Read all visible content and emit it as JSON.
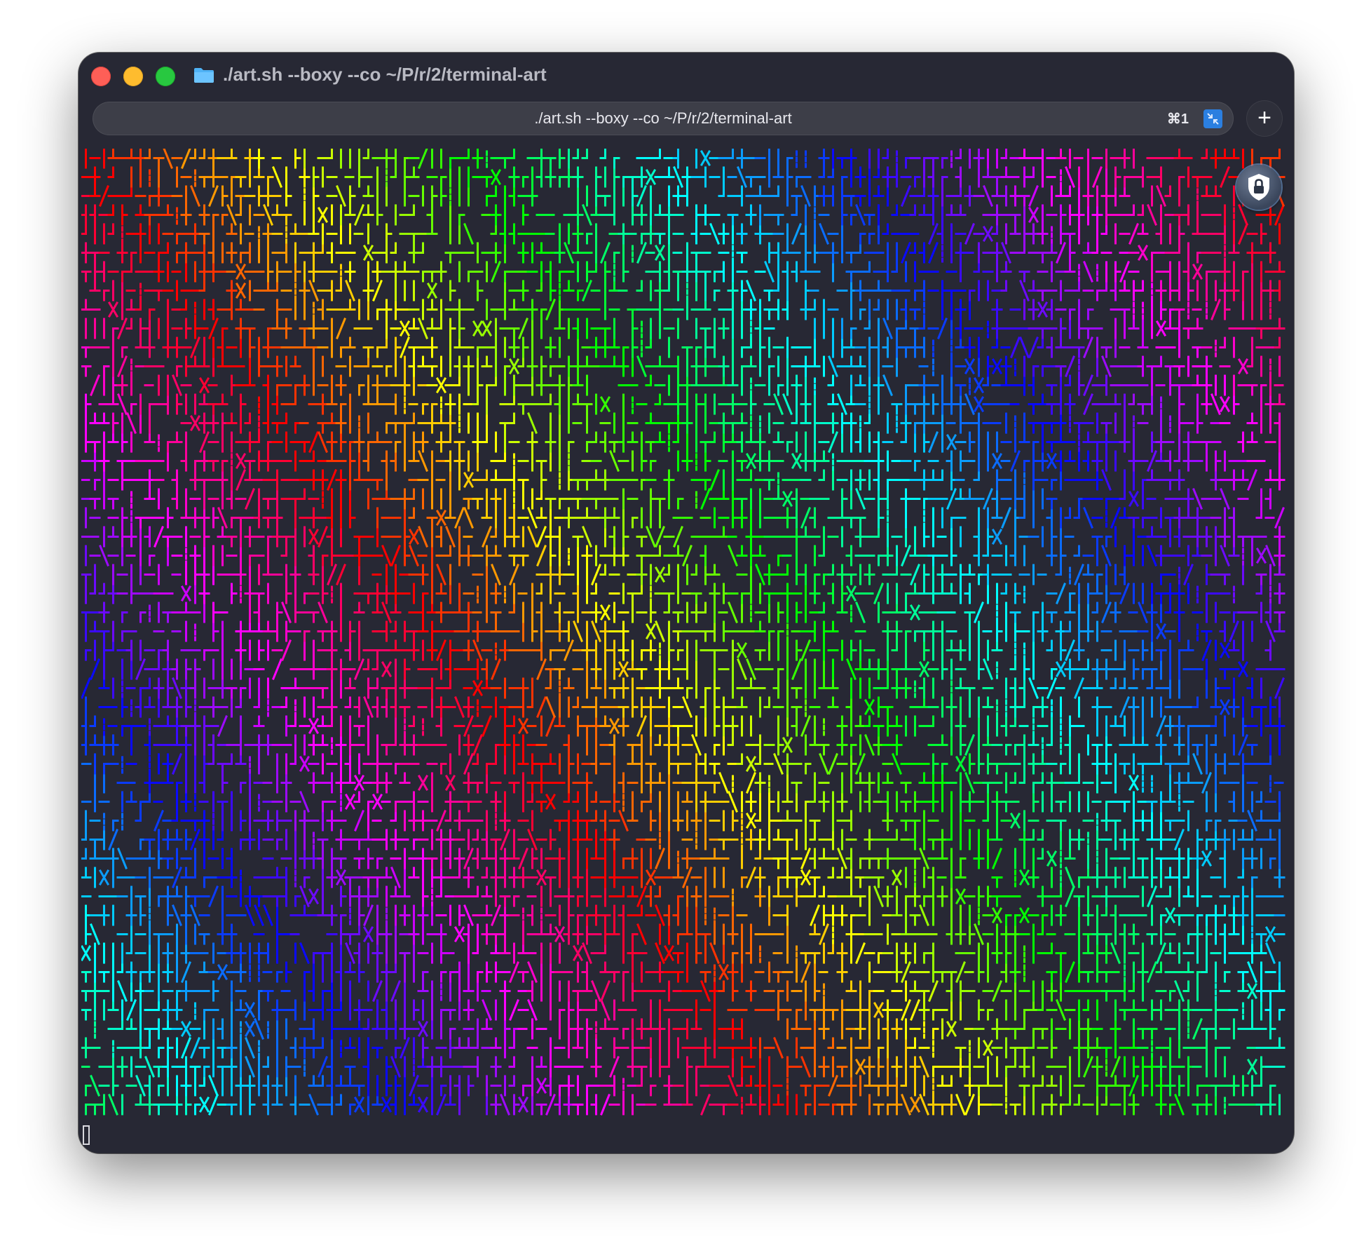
{
  "window": {
    "title": "./art.sh --boxy --co ~/P/r/2/terminal-art",
    "background": "#272834"
  },
  "tab": {
    "title": "./art.sh --boxy --co ~/P/r/2/terminal-art",
    "shortcut": "⌘1",
    "badge_icon": "split-view-icon",
    "new_tab_label": "+"
  },
  "terminal": {
    "content": "rainbow box-drawing art",
    "glyphs": [
      "│",
      "─",
      "┼",
      "├",
      "┤",
      "┬",
      "┴",
      "┌",
      "┐",
      "└",
      "┘",
      "╷",
      "╵",
      "┊",
      "╌",
      "╱",
      "╲",
      "╳",
      "═",
      "║"
    ],
    "colors": [
      "#ff1a1a",
      "#ff7a00",
      "#ffd800",
      "#66ff00",
      "#00e676",
      "#00d4ff",
      "#0066ff",
      "#2200ff",
      "#9900ff",
      "#ff00d0"
    ],
    "lock_icon": "lock-shield-icon",
    "cursor": "block-cursor"
  }
}
